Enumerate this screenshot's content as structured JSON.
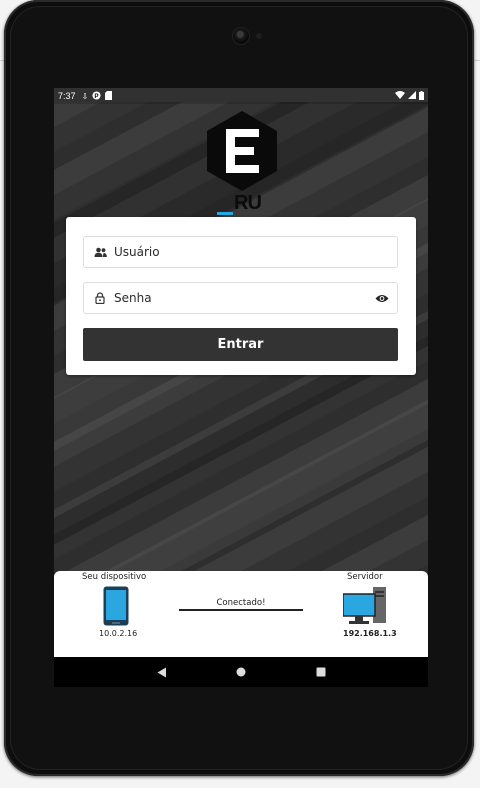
{
  "status_bar": {
    "time": "7:37",
    "icons_left": [
      "download-icon",
      "p-icon",
      "sd-icon"
    ],
    "icons_right": [
      "wifi-icon",
      "signal-icon",
      "battery-icon"
    ]
  },
  "logo": {
    "text": "ERU",
    "accent_color": "#2aa7e0"
  },
  "login": {
    "username_placeholder": "Usuário",
    "password_placeholder": "Senha",
    "submit_label": "Entrar"
  },
  "connection": {
    "device_label": "Seu dispositivo",
    "device_ip": "10.0.2.16",
    "server_label": "Servidor",
    "server_ip": "192.168.1.3",
    "status_text": "Conectado!"
  },
  "colors": {
    "button_bg": "#333333",
    "screen_accent": "#2aa7e0"
  }
}
